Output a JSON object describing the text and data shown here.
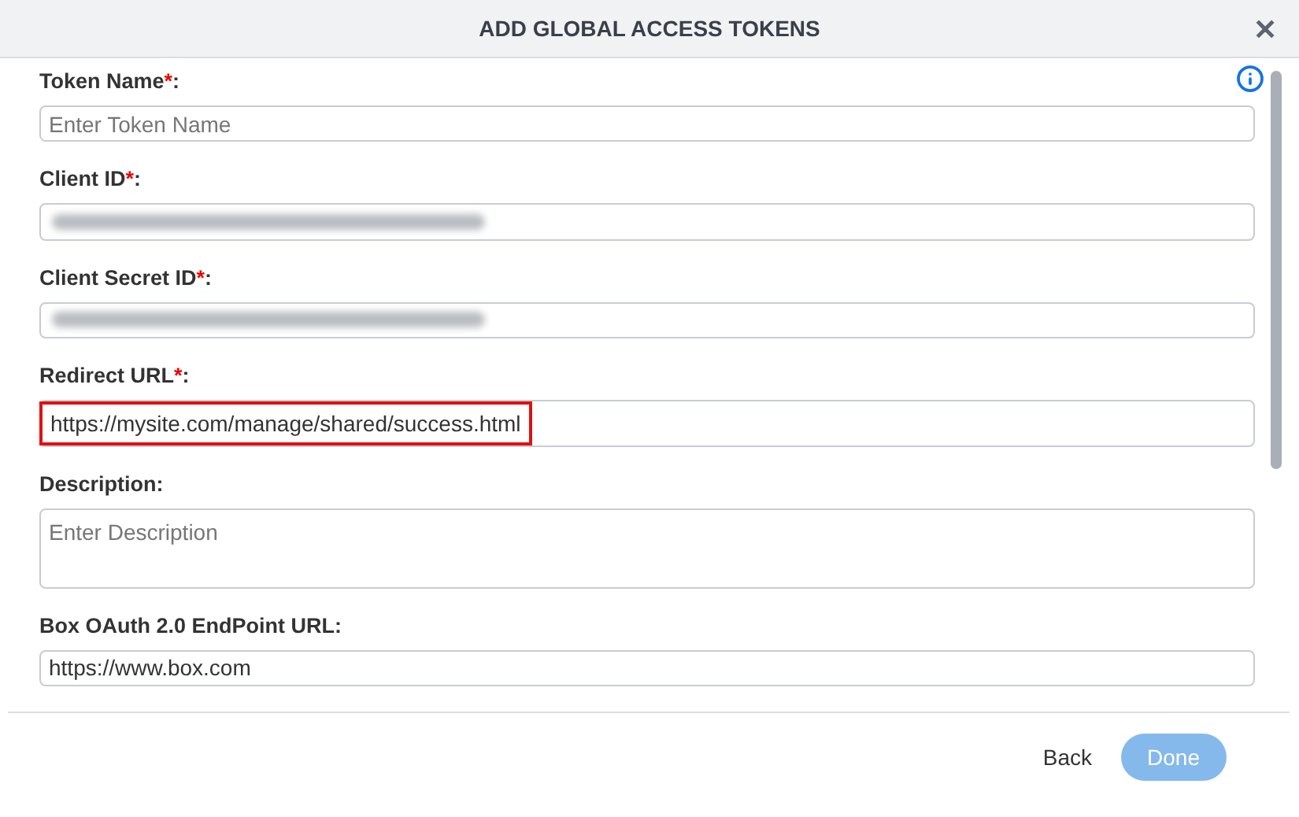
{
  "dialog": {
    "title": "ADD GLOBAL ACCESS TOKENS",
    "close": "✕"
  },
  "fields": [
    {
      "label": "Token Name",
      "required_mark": "*",
      "suffix": ":",
      "kind": "input",
      "placeholder": "Enter Token Name"
    },
    {
      "label": "Client ID",
      "required_mark": "*",
      "suffix": ":",
      "kind": "masked"
    },
    {
      "label": "Client Secret ID",
      "required_mark": "*",
      "suffix": ":",
      "kind": "masked"
    },
    {
      "label": "Redirect URL",
      "required_mark": "*",
      "suffix": ":",
      "kind": "input",
      "value": "https://mysite.com/manage/shared/success.html",
      "highlighted": true
    },
    {
      "label": "Description",
      "suffix": ":",
      "kind": "textarea",
      "placeholder": "Enter Description"
    },
    {
      "label": "Box OAuth 2.0 EndPoint URL",
      "suffix": ":",
      "kind": "input",
      "value": "https://www.box.com"
    }
  ],
  "buttons": [
    {
      "label": "Back",
      "kind": "link",
      "disabled": false
    },
    {
      "label": "Done",
      "kind": "primary",
      "disabled": true
    }
  ]
}
